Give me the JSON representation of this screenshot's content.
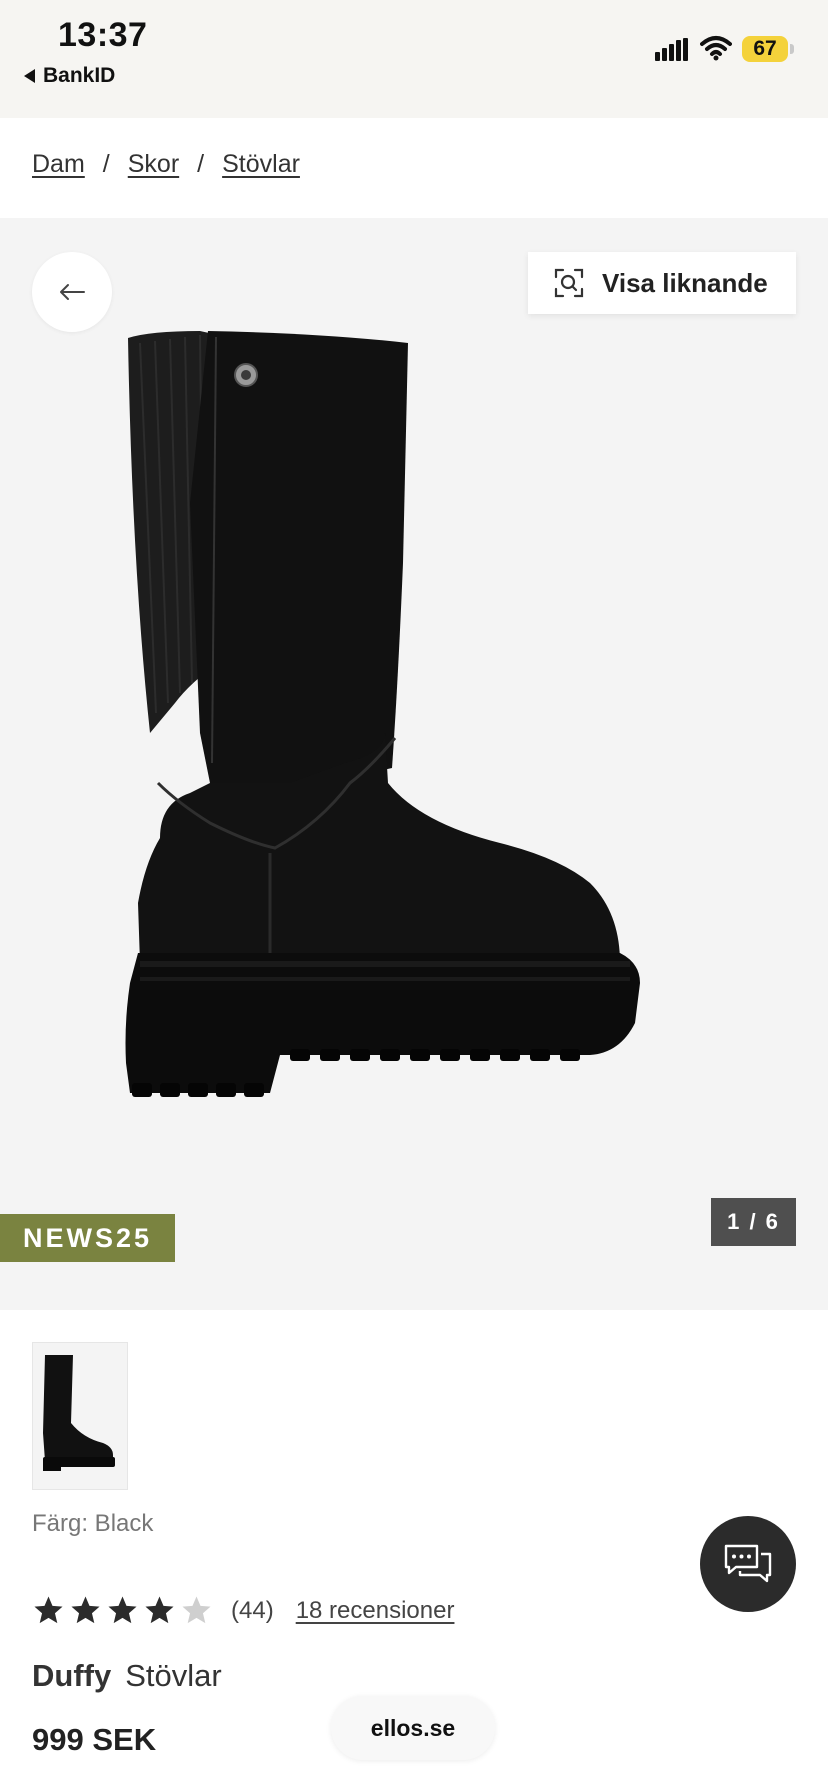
{
  "status_bar": {
    "time": "13:37",
    "back_app": "BankID",
    "battery": "67"
  },
  "breadcrumb": [
    {
      "label": "Dam"
    },
    {
      "label": "Skor"
    },
    {
      "label": "Stövlar"
    }
  ],
  "breadcrumb_separator": "/",
  "gallery": {
    "similar_label": "Visa liknande",
    "promo_code": "NEWS25",
    "counter": "1 / 6"
  },
  "product": {
    "color_text": "Färg: Black",
    "rating_stars": 4,
    "rating_max": 5,
    "rating_count": "(44)",
    "reviews_label": "18 recensioner",
    "brand": "Duffy",
    "name": "Stövlar",
    "price": "999 SEK"
  },
  "footer": {
    "site": "ellos.se"
  },
  "colors": {
    "promo_bg": "#7a8340",
    "star_filled": "#2b2b2b",
    "star_empty": "#cfcfcf",
    "battery": "#f4d23b"
  },
  "icons": [
    "back-arrow-icon",
    "visual-search-icon",
    "chat-icon",
    "star-icon",
    "signal-icon",
    "wifi-icon"
  ]
}
